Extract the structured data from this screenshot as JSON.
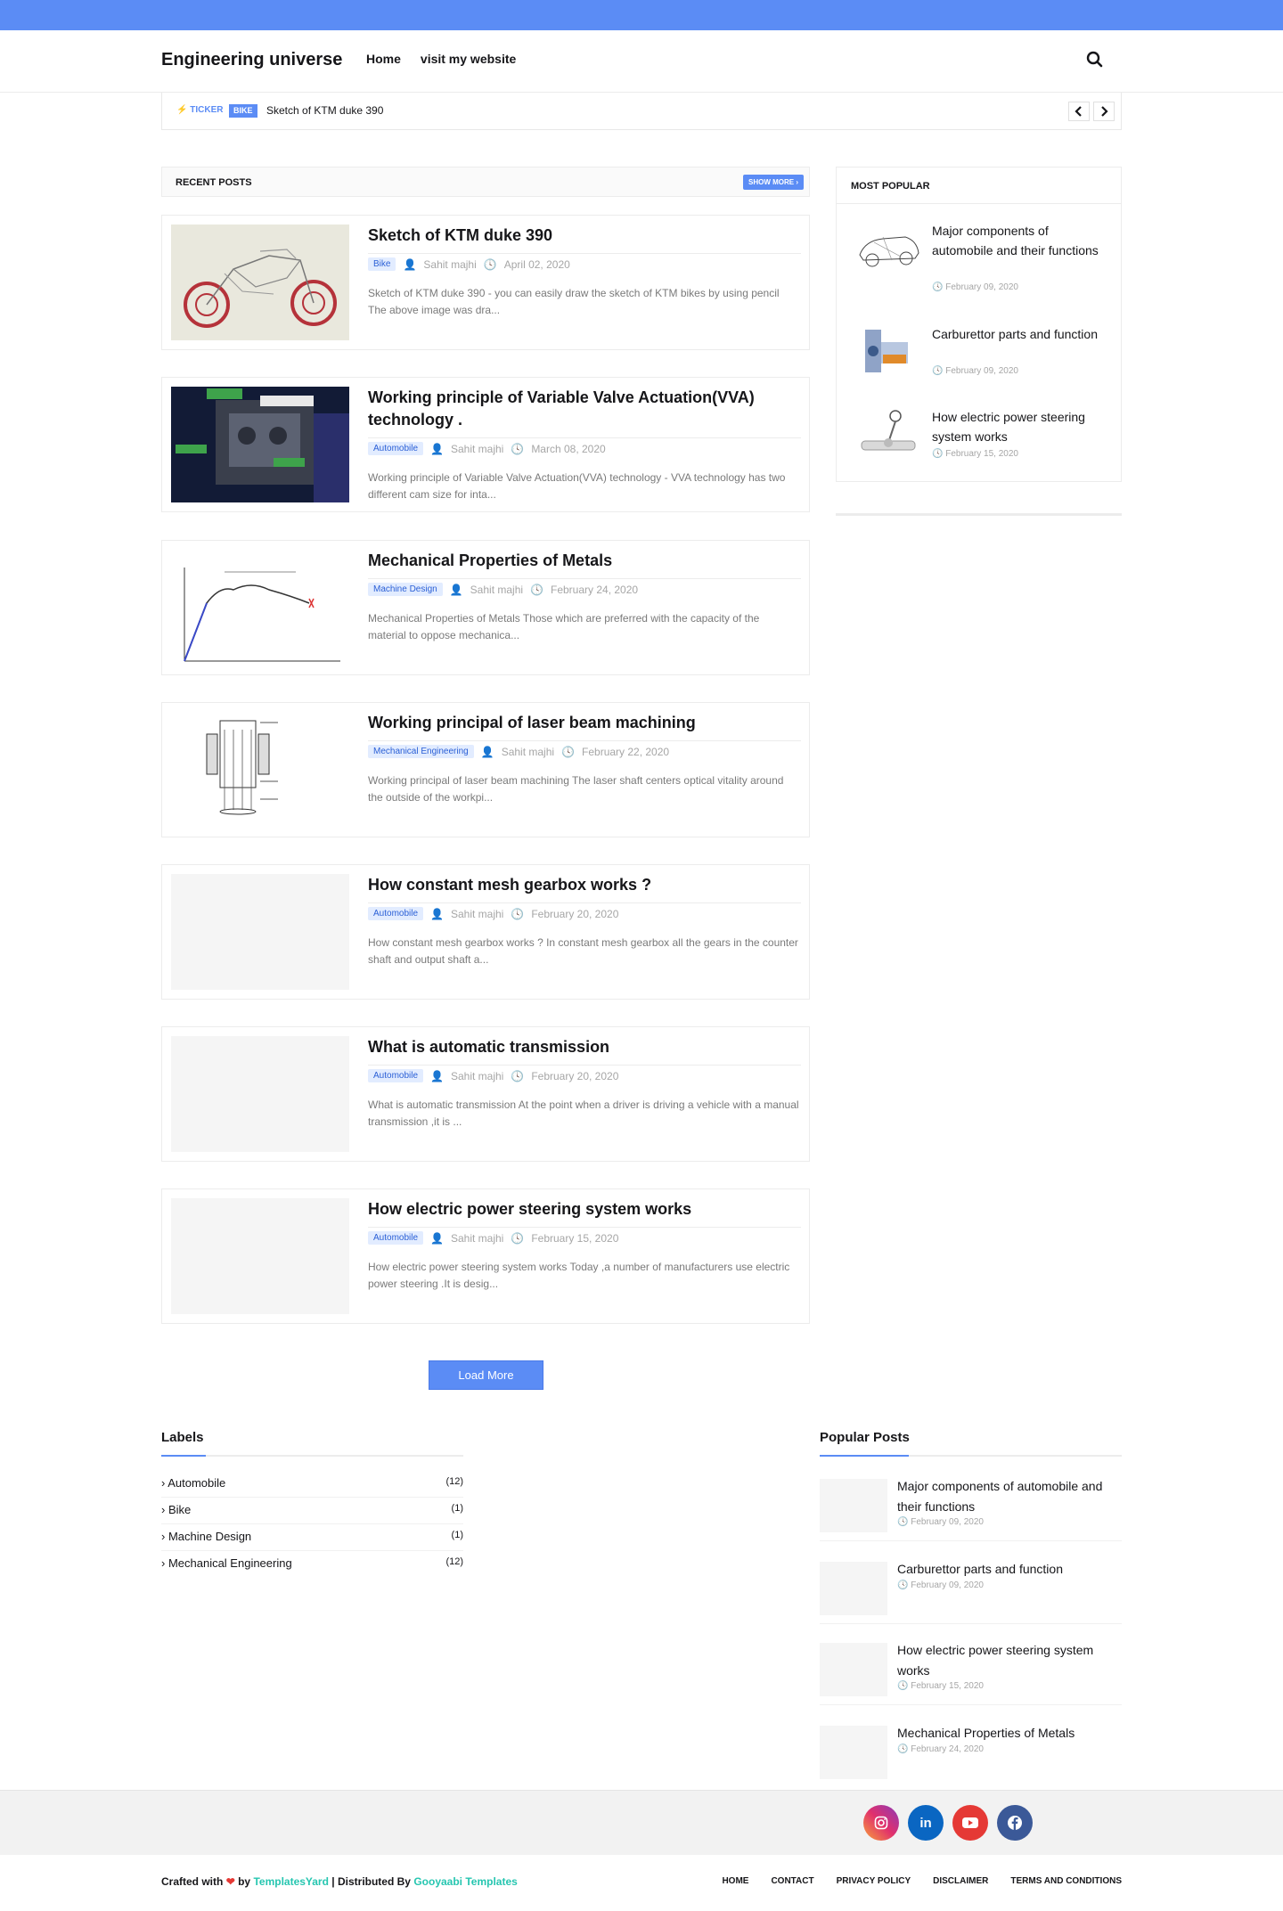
{
  "header": {
    "brand": "Engineering universe",
    "nav": [
      "Home",
      "visit my website"
    ]
  },
  "ticker": {
    "label": "TICKER",
    "tag": "BIKE",
    "text": "Sketch of KTM duke 390"
  },
  "recent": {
    "title": "RECENT POSTS",
    "show_more": "SHOW MORE"
  },
  "posts": [
    {
      "title": "Sketch of KTM duke 390",
      "category": "Bike",
      "author": "Sahit majhi",
      "date": "April 02, 2020",
      "snippet": "Sketch of KTM duke 390 - you can easily draw the sketch of KTM bikes by using pencil      The above image was dra..."
    },
    {
      "title": "Working principle of Variable Valve Actuation(VVA) technology .",
      "category": "Automobile",
      "author": "Sahit majhi",
      "date": "March 08, 2020",
      "snippet": "Working principle of Variable Valve Actuation(VVA) technology - VVA technology has two different cam size for inta..."
    },
    {
      "title": "Mechanical Properties of Metals",
      "category": "Machine Design",
      "author": "Sahit majhi",
      "date": "February 24, 2020",
      "snippet": "Mechanical Properties of Metals Those which are preferred with the capacity of the material to oppose mechanica..."
    },
    {
      "title": "Working principal of laser beam machining",
      "category": "Mechanical Engineering",
      "author": "Sahit majhi",
      "date": "February 22, 2020",
      "snippet": "Working principal of laser beam machining The laser shaft centers optical vitality around the outside of the workpi..."
    },
    {
      "title": "How constant mesh gearbox works ?",
      "category": "Automobile",
      "author": "Sahit majhi",
      "date": "February 20, 2020",
      "snippet": "How  constant mesh gearbox works ? In constant mesh gearbox all the gears in the counter shaft and output shaft a..."
    },
    {
      "title": "What is automatic transmission",
      "category": "Automobile",
      "author": "Sahit majhi",
      "date": "February 20, 2020",
      "snippet": "What is automatic transmission At the point when a driver is driving a vehicle with a manual transmission ,it is ..."
    },
    {
      "title": "How electric power steering system works",
      "category": "Automobile",
      "author": "Sahit majhi",
      "date": "February 15, 2020",
      "snippet": "How electric power steering system works Today ,a number of manufacturers use electric power steering .It is desig..."
    }
  ],
  "load_more": "Load More",
  "most_popular": {
    "title": "MOST POPULAR",
    "items": [
      {
        "title": "Major components of automobile and their functions",
        "date": "February 09, 2020"
      },
      {
        "title": "Carburettor parts and function",
        "date": "February 09, 2020"
      },
      {
        "title": "How electric power steering system works",
        "date": "February 15, 2020"
      }
    ]
  },
  "labels": {
    "title": "Labels",
    "items": [
      {
        "name": "› Automobile",
        "count": "(12)"
      },
      {
        "name": "› Bike",
        "count": "(1)"
      },
      {
        "name": "› Machine Design",
        "count": "(1)"
      },
      {
        "name": "› Mechanical Engineering",
        "count": "(12)"
      }
    ]
  },
  "popular_posts": {
    "title": "Popular Posts",
    "items": [
      {
        "title": "Major components of automobile and their functions",
        "date": "February 09, 2020"
      },
      {
        "title": "Carburettor parts and function",
        "date": "February 09, 2020"
      },
      {
        "title": "How electric power steering system works",
        "date": "February 15, 2020"
      },
      {
        "title": "Mechanical Properties of Metals",
        "date": "February 24, 2020"
      }
    ]
  },
  "social": [
    {
      "icon": "instagram-icon",
      "color": "#d6249f"
    },
    {
      "icon": "linkedin-icon",
      "color": "#0a66c2"
    },
    {
      "icon": "youtube-icon",
      "color": "#e53935"
    },
    {
      "icon": "facebook-icon",
      "color": "#3b5998"
    }
  ],
  "footer": {
    "crafted": "Crafted with",
    "by": "by",
    "templatesyard": "TemplatesYard",
    "distributed": "| Distributed By",
    "gooyaabi": "Gooyaabi Templates",
    "links": [
      "HOME",
      "CONTACT",
      "PRIVACY POLICY",
      "DISCLAIMER",
      "TERMS AND CONDITIONS"
    ]
  },
  "colors": {
    "accent": "#5b8cf5",
    "credit_green": "#26c6b0"
  }
}
